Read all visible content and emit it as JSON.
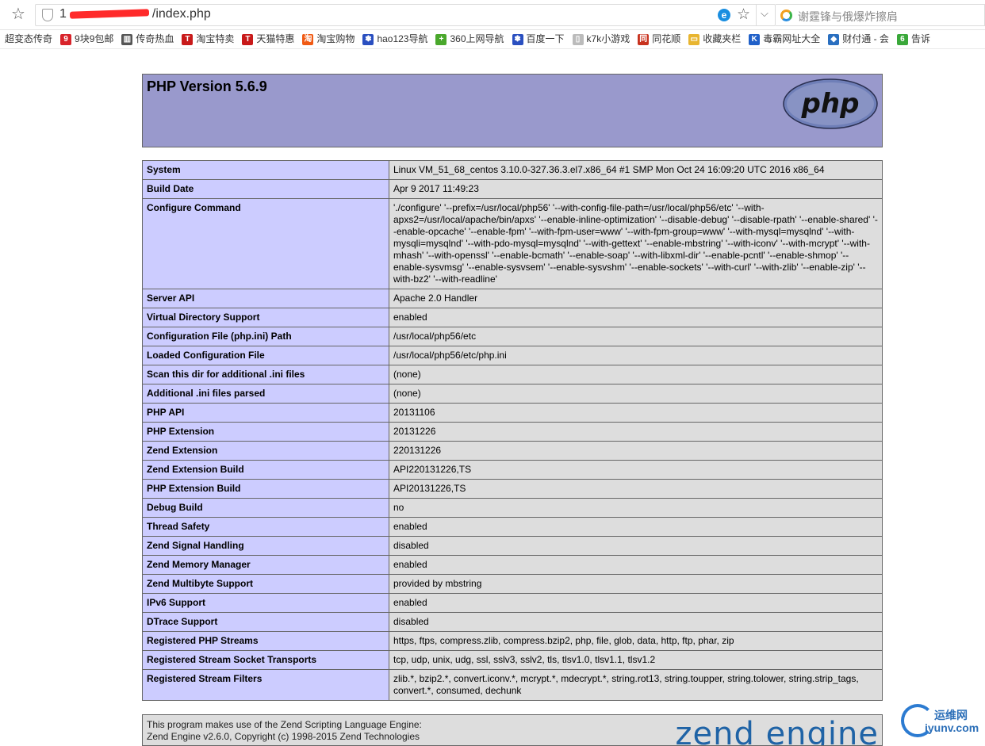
{
  "browser": {
    "url_prefix": "1",
    "url_suffix": "/index.php",
    "search_placeholder": "谢霆锋与俄爆炸擦肩"
  },
  "bookmarks": [
    {
      "label": "超变态传奇",
      "icon": "",
      "color": ""
    },
    {
      "label": "9块9包邮",
      "icon": "9",
      "color": "#d8232a"
    },
    {
      "label": "传奇热血",
      "icon": "▥",
      "color": "#555555"
    },
    {
      "label": "淘宝特卖",
      "icon": "T",
      "color": "#c81a1a"
    },
    {
      "label": "天猫特惠",
      "icon": "T",
      "color": "#c81a1a"
    },
    {
      "label": "淘宝购物",
      "icon": "淘",
      "color": "#f05a14"
    },
    {
      "label": "hao123导航",
      "icon": "✽",
      "color": "#2a4fc0"
    },
    {
      "label": "360上网导航",
      "icon": "+",
      "color": "#4aa82c"
    },
    {
      "label": "百度一下",
      "icon": "✽",
      "color": "#2a4fc0"
    },
    {
      "label": "k7k小游戏",
      "icon": "▯",
      "color": "#bbbbbb"
    },
    {
      "label": "同花顺",
      "icon": "同",
      "color": "#c8321e"
    },
    {
      "label": "收藏夹栏",
      "icon": "▭",
      "color": "#e8b530"
    },
    {
      "label": "毒霸网址大全",
      "icon": "K",
      "color": "#2060c8"
    },
    {
      "label": "财付通 - 会",
      "icon": "◆",
      "color": "#2a6fc0"
    },
    {
      "label": "告诉",
      "icon": "6",
      "color": "#3aa83a"
    }
  ],
  "phpinfo": {
    "title": "PHP Version 5.6.9",
    "logo_text": "php",
    "rows": [
      {
        "key": "System",
        "value": "Linux VM_51_68_centos 3.10.0-327.36.3.el7.x86_64 #1 SMP Mon Oct 24 16:09:20 UTC 2016 x86_64"
      },
      {
        "key": "Build Date",
        "value": "Apr 9 2017 11:49:23"
      },
      {
        "key": "Configure Command",
        "value": "'./configure' '--prefix=/usr/local/php56' '--with-config-file-path=/usr/local/php56/etc' '--with-apxs2=/usr/local/apache/bin/apxs' '--enable-inline-optimization' '--disable-debug' '--disable-rpath' '--enable-shared' '--enable-opcache' '--enable-fpm' '--with-fpm-user=www' '--with-fpm-group=www' '--with-mysql=mysqlnd' '--with-mysqli=mysqlnd' '--with-pdo-mysql=mysqlnd' '--with-gettext' '--enable-mbstring' '--with-iconv' '--with-mcrypt' '--with-mhash' '--with-openssl' '--enable-bcmath' '--enable-soap' '--with-libxml-dir' '--enable-pcntl' '--enable-shmop' '--enable-sysvmsg' '--enable-sysvsem' '--enable-sysvshm' '--enable-sockets' '--with-curl' '--with-zlib' '--enable-zip' '--with-bz2' '--with-readline'"
      },
      {
        "key": "Server API",
        "value": "Apache 2.0 Handler"
      },
      {
        "key": "Virtual Directory Support",
        "value": "enabled"
      },
      {
        "key": "Configuration File (php.ini) Path",
        "value": "/usr/local/php56/etc"
      },
      {
        "key": "Loaded Configuration File",
        "value": "/usr/local/php56/etc/php.ini"
      },
      {
        "key": "Scan this dir for additional .ini files",
        "value": "(none)"
      },
      {
        "key": "Additional .ini files parsed",
        "value": "(none)"
      },
      {
        "key": "PHP API",
        "value": "20131106"
      },
      {
        "key": "PHP Extension",
        "value": "20131226"
      },
      {
        "key": "Zend Extension",
        "value": "220131226"
      },
      {
        "key": "Zend Extension Build",
        "value": "API220131226,TS"
      },
      {
        "key": "PHP Extension Build",
        "value": "API20131226,TS"
      },
      {
        "key": "Debug Build",
        "value": "no"
      },
      {
        "key": "Thread Safety",
        "value": "enabled"
      },
      {
        "key": "Zend Signal Handling",
        "value": "disabled"
      },
      {
        "key": "Zend Memory Manager",
        "value": "enabled"
      },
      {
        "key": "Zend Multibyte Support",
        "value": "provided by mbstring"
      },
      {
        "key": "IPv6 Support",
        "value": "enabled"
      },
      {
        "key": "DTrace Support",
        "value": "disabled"
      },
      {
        "key": "Registered PHP Streams",
        "value": "https, ftps, compress.zlib, compress.bzip2, php, file, glob, data, http, ftp, phar, zip"
      },
      {
        "key": "Registered Stream Socket Transports",
        "value": "tcp, udp, unix, udg, ssl, sslv3, sslv2, tls, tlsv1.0, tlsv1.1, tlsv1.2"
      },
      {
        "key": "Registered Stream Filters",
        "value": "zlib.*, bzip2.*, convert.iconv.*, mcrypt.*, mdecrypt.*, string.rot13, string.toupper, string.tolower, string.strip_tags, convert.*, consumed, dechunk"
      }
    ],
    "footer_line1": "This program makes use of the Zend Scripting Language Engine:",
    "footer_line2": "Zend Engine v2.6.0, Copyright (c) 1998-2015 Zend Technologies",
    "zend_logo": "zend engine"
  },
  "watermark": {
    "cn": "运维网",
    "en": "iyunv.com"
  }
}
